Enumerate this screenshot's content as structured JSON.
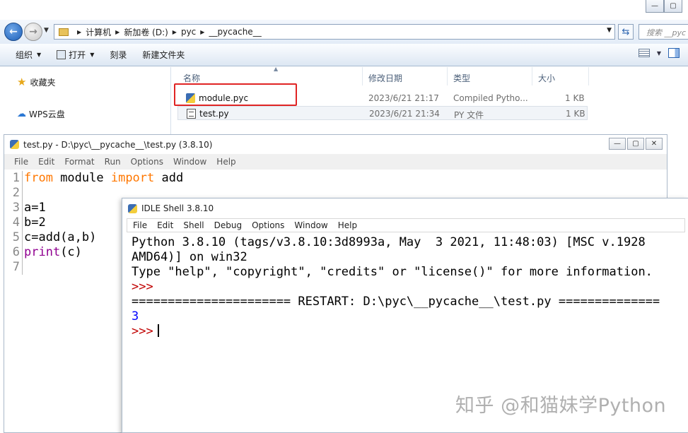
{
  "explorer": {
    "breadcrumb": [
      "计算机",
      "新加卷 (D:)",
      "pyc",
      "__pycache__"
    ],
    "search_placeholder": "搜索 __pyc",
    "toolbar": {
      "organize": "组织",
      "open": "打开",
      "burn": "刻录",
      "new_folder": "新建文件夹"
    },
    "nav": {
      "favorites": "收藏夹",
      "wps_cloud": "WPS云盘"
    },
    "columns": {
      "name": "名称",
      "modified": "修改日期",
      "type": "类型",
      "size": "大小"
    },
    "files": [
      {
        "name": "module.pyc",
        "modified": "2023/6/21 21:17",
        "type": "Compiled Pytho...",
        "size": "1 KB"
      },
      {
        "name": "test.py",
        "modified": "2023/6/21 21:34",
        "type": "PY 文件",
        "size": "1 KB"
      }
    ],
    "highlight_color": "#e02424"
  },
  "editor": {
    "title": "test.py - D:\\pyc\\__pycache__\\test.py (3.8.10)",
    "menu": [
      "File",
      "Edit",
      "Format",
      "Run",
      "Options",
      "Window",
      "Help"
    ],
    "line_numbers": [
      "1",
      "2",
      "3",
      "4",
      "5",
      "6",
      "7"
    ],
    "code": {
      "l1_kw1": "from",
      "l1_mid": " module ",
      "l1_kw2": "import",
      "l1_end": " add",
      "l3": "a=1",
      "l4": "b=2",
      "l5": "c=add(a,b)",
      "l6_bi": "print",
      "l6_end": "(c)"
    },
    "keyword_color": "#ff7700",
    "builtin_color": "#900090"
  },
  "shell": {
    "title": "IDLE Shell 3.8.10",
    "menu": [
      "File",
      "Edit",
      "Shell",
      "Debug",
      "Options",
      "Window",
      "Help"
    ],
    "lines": {
      "banner1": "Python 3.8.10 (tags/v3.8.10:3d8993a, May  3 2021, 11:48:03) [MSC v.1928",
      "banner2": "AMD64)] on win32",
      "banner3": "Type \"help\", \"copyright\", \"credits\" or \"license()\" for more information.",
      "prompt": ">>>",
      "restart": "====================== RESTART: D:\\pyc\\__pycache__\\test.py ==============",
      "output": "3"
    },
    "prompt_color": "#c00000",
    "output_color": "#0000ff"
  },
  "watermark": "知乎 @和猫妹学Python"
}
